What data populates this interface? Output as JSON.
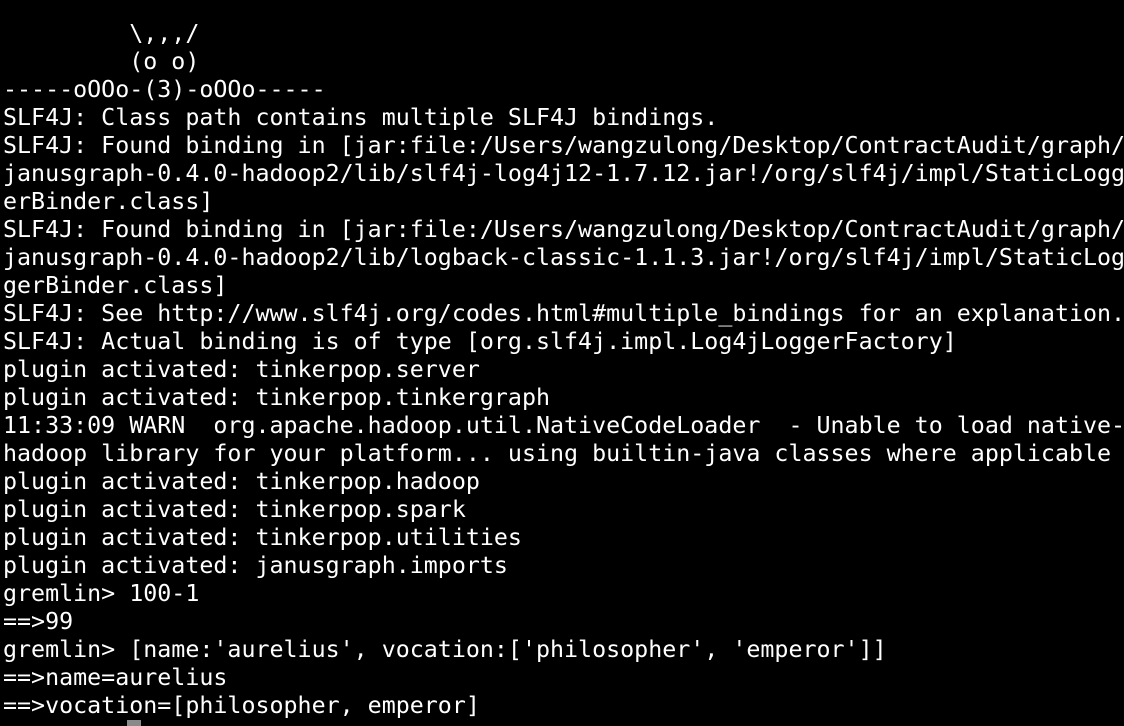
{
  "terminal": {
    "lines": [
      "         \\,,,/",
      "         (o o)",
      "-----oOOo-(3)-oOOo-----",
      "SLF4J: Class path contains multiple SLF4J bindings.",
      "SLF4J: Found binding in [jar:file:/Users/wangzulong/Desktop/ContractAudit/graph/",
      "janusgraph-0.4.0-hadoop2/lib/slf4j-log4j12-1.7.12.jar!/org/slf4j/impl/StaticLogg",
      "erBinder.class]",
      "SLF4J: Found binding in [jar:file:/Users/wangzulong/Desktop/ContractAudit/graph/",
      "janusgraph-0.4.0-hadoop2/lib/logback-classic-1.1.3.jar!/org/slf4j/impl/StaticLog",
      "gerBinder.class]",
      "SLF4J: See http://www.slf4j.org/codes.html#multiple_bindings for an explanation.",
      "SLF4J: Actual binding is of type [org.slf4j.impl.Log4jLoggerFactory]",
      "plugin activated: tinkerpop.server",
      "plugin activated: tinkerpop.tinkergraph",
      "11:33:09 WARN  org.apache.hadoop.util.NativeCodeLoader  - Unable to load native-",
      "hadoop library for your platform... using builtin-java classes where applicable",
      "plugin activated: tinkerpop.hadoop",
      "plugin activated: tinkerpop.spark",
      "plugin activated: tinkerpop.utilities",
      "plugin activated: janusgraph.imports",
      "gremlin> 100-1",
      "==>99",
      "gremlin> [name:'aurelius', vocation:['philosopher', 'emperor']]",
      "==>name=aurelius",
      "==>vocation=[philosopher, emperor]"
    ],
    "colors": {
      "background": "#000000",
      "text": "#ffffff",
      "cursor": "#8a8a8a"
    }
  }
}
